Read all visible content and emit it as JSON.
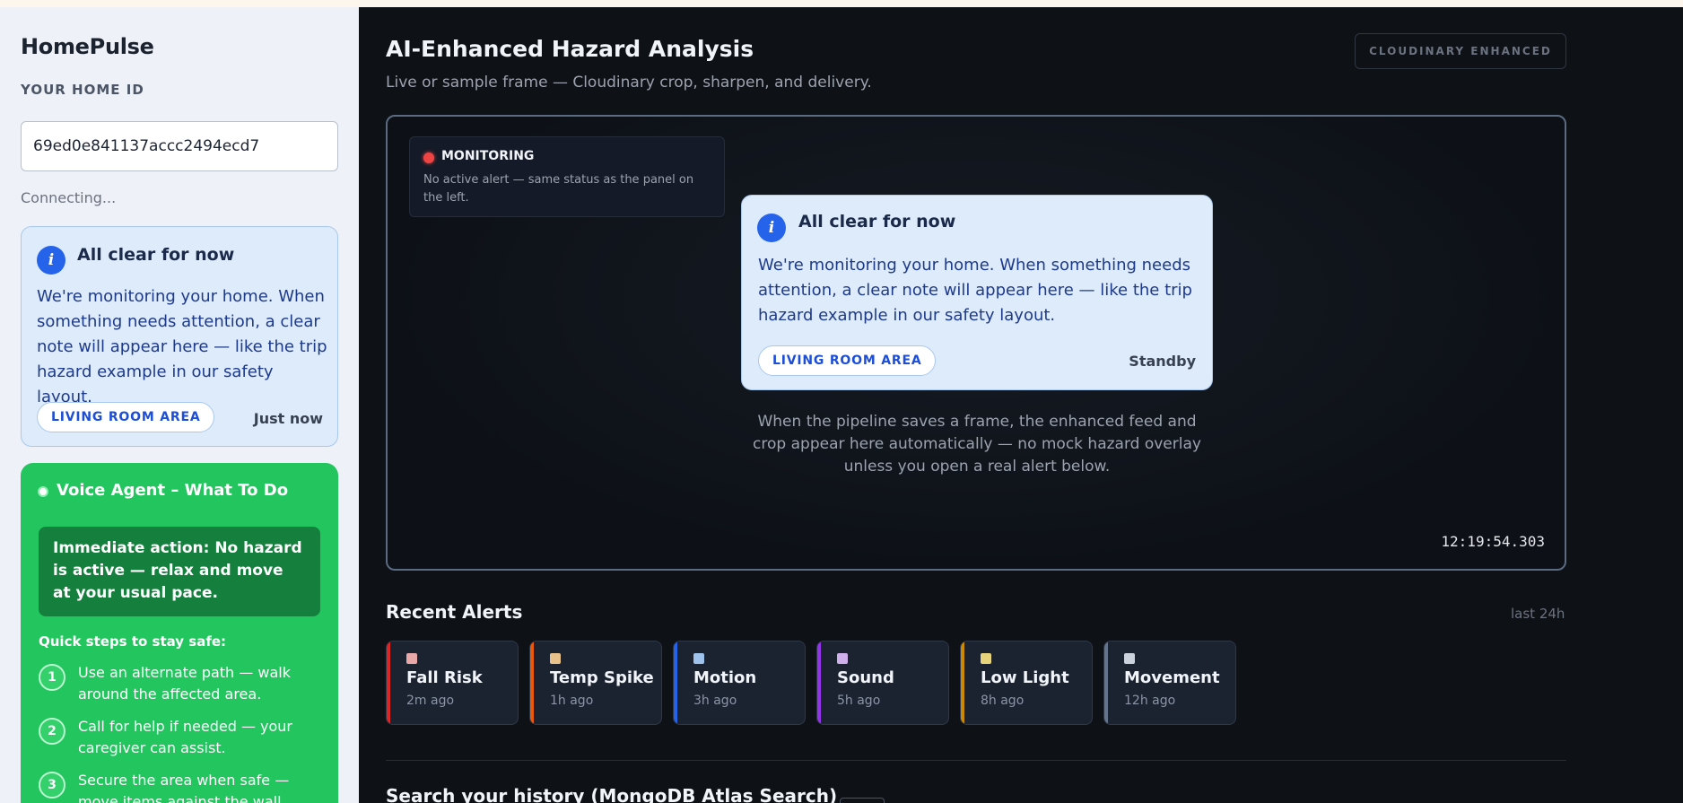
{
  "sidebar": {
    "brand": "HomePulse",
    "home_id_label": "YOUR HOME ID",
    "home_id_value": "69ed0e841137accc2494ecd7",
    "status": "Connecting...",
    "clear_card": {
      "icon": "info-icon",
      "icon_glyph": "i",
      "title": "All clear for now",
      "body": "We're monitoring your home. When something needs attention, a clear note will appear here — like the trip hazard example in our safety layout.",
      "area": "LIVING ROOM AREA",
      "time": "Just now"
    },
    "voice_agent": {
      "title": "Voice Agent – What To Do",
      "immediate": "Immediate action: No hazard is active — relax and move at your usual pace.",
      "quick_steps_label": "Quick steps to stay safe:",
      "steps": [
        {
          "num": "1",
          "text": "Use an alternate path — walk around the affected area."
        },
        {
          "num": "2",
          "text": "Call for help if needed — your caregiver can assist."
        },
        {
          "num": "3",
          "text": "Secure the area when safe — move items against the wall."
        }
      ]
    }
  },
  "main": {
    "title": "AI-Enhanced Hazard Analysis",
    "subtitle": "Live or sample frame — Cloudinary crop, sharpen, and delivery.",
    "badge": "CLOUDINARY ENHANCED",
    "frame": {
      "monitoring_label": "MONITORING",
      "monitoring_text": "No active alert — same status as the panel on the left.",
      "card": {
        "icon_glyph": "i",
        "title": "All clear for now",
        "body": "We're monitoring your home. When something needs attention, a clear note will appear here — like the trip hazard example in our safety layout.",
        "area": "LIVING ROOM AREA",
        "status": "Standby"
      },
      "pipeline_text": "When the pipeline saves a frame, the enhanced feed and crop appear here automatically — no mock hazard overlay unless you open a real alert below.",
      "timestamp": "12:19:54.303"
    },
    "recent_alerts": {
      "title": "Recent Alerts",
      "range": "last 24h",
      "items": [
        {
          "name": "Fall Risk",
          "time": "2m ago",
          "bar": "#dc2626",
          "square": "#e8a8a8"
        },
        {
          "name": "Temp Spike",
          "time": "1h ago",
          "bar": "#ea580c",
          "square": "#e8c28a"
        },
        {
          "name": "Motion",
          "time": "3h ago",
          "bar": "#2563eb",
          "square": "#9ec2ec"
        },
        {
          "name": "Sound",
          "time": "5h ago",
          "bar": "#9333ea",
          "square": "#d0b0ea"
        },
        {
          "name": "Low Light",
          "time": "8h ago",
          "bar": "#ca8a04",
          "square": "#e8d47a"
        },
        {
          "name": "Movement",
          "time": "12h ago",
          "bar": "#64748b",
          "square": "#cbd2db"
        }
      ]
    },
    "search_title": "Search your history (MongoDB Atlas Search)"
  }
}
